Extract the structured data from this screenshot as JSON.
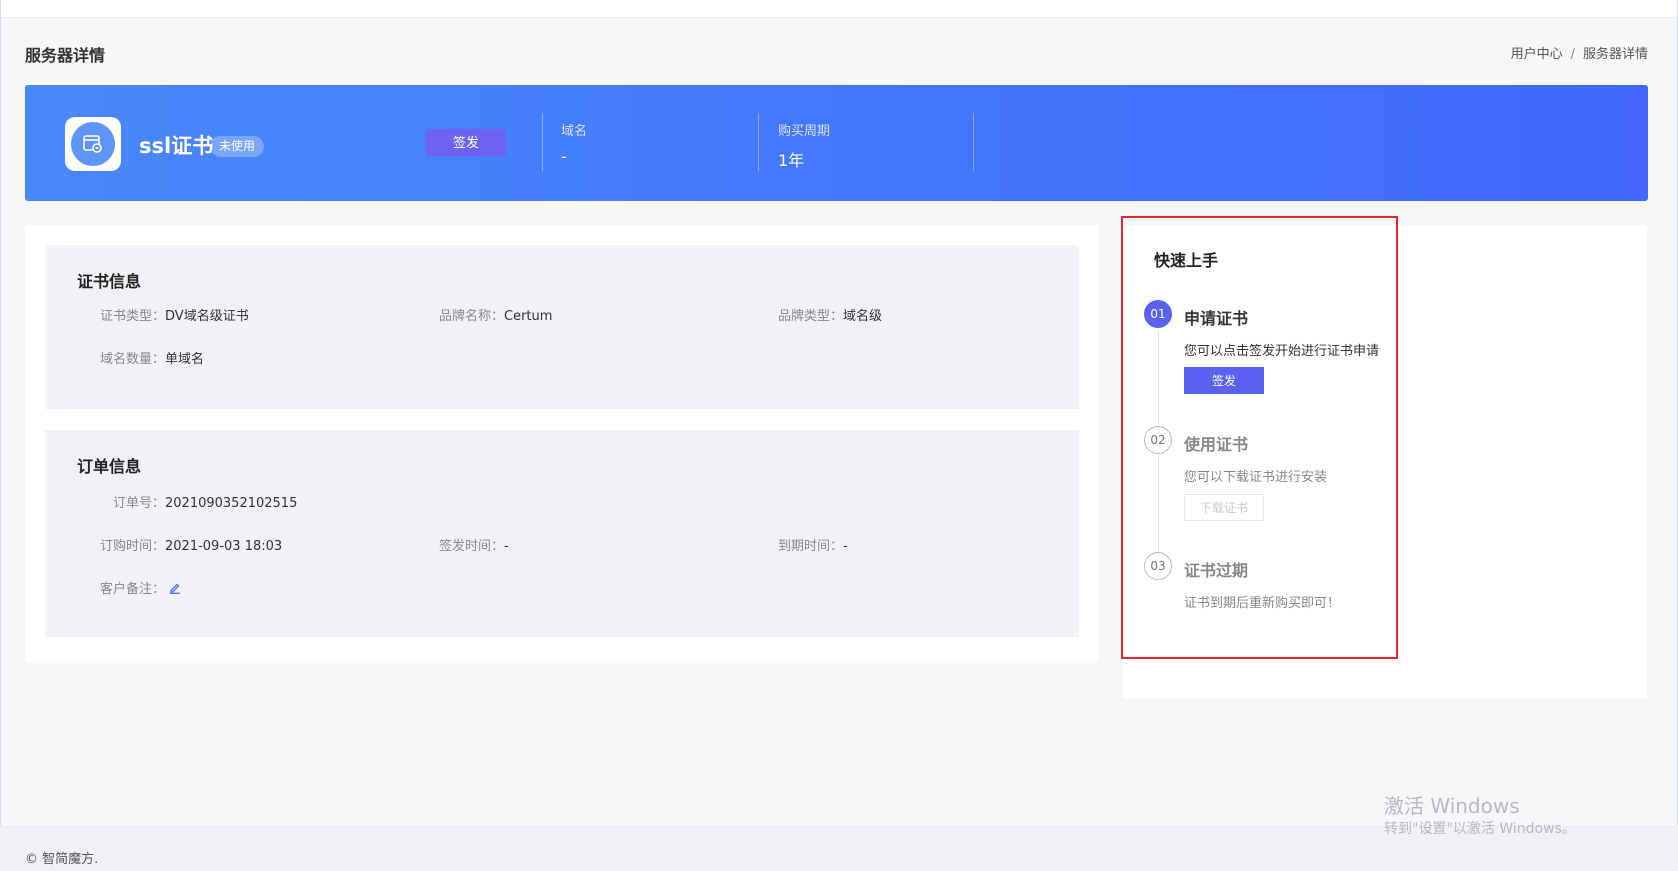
{
  "page": {
    "title": "服务器详情",
    "breadcrumb": {
      "home": "用户中心",
      "current": "服务器详情"
    }
  },
  "banner": {
    "product_name": "ssl证书",
    "status": "未使用",
    "issue_button": "签发",
    "domain_label": "域名",
    "domain_value": "-",
    "period_label": "购买周期",
    "period_value": "1年",
    "logo_icon": "certificate-icon"
  },
  "cert_info": {
    "title": "证书信息",
    "cert_type_label": "证书类型：",
    "cert_type_value": "DV域名级证书",
    "brand_name_label": "品牌名称：",
    "brand_name_value": "Certum",
    "brand_type_label": "品牌类型：",
    "brand_type_value": "域名级",
    "domain_count_label": "域名数量：",
    "domain_count_value": "单域名"
  },
  "order_info": {
    "title": "订单信息",
    "order_no_label": "订单号：",
    "order_no_value": "2021090352102515",
    "order_time_label": "订购时间：",
    "order_time_value": "2021-09-03 18:03",
    "issue_time_label": "签发时间：",
    "issue_time_value": "-",
    "expire_time_label": "到期时间：",
    "expire_time_value": "-",
    "remark_label": "客户备注：",
    "remark_icon": "edit-icon"
  },
  "quick_start": {
    "title": "快速上手",
    "steps": [
      {
        "num": "01",
        "title": "申请证书",
        "desc": "您可以点击签发开始进行证书申请",
        "button": "签发"
      },
      {
        "num": "02",
        "title": "使用证书",
        "desc": "您可以下载证书进行安装",
        "button": "下载证书"
      },
      {
        "num": "03",
        "title": "证书过期",
        "desc": "证书到期后重新购买即可！"
      }
    ]
  },
  "footer": {
    "copyright": "© 智简魔方."
  },
  "watermark": {
    "title": "激活 Windows",
    "subtitle": "转到\"设置\"以激活 Windows。"
  },
  "colors": {
    "banner": "#4277fb",
    "accent": "#5b61f0",
    "highlight_border": "#e4262f"
  }
}
